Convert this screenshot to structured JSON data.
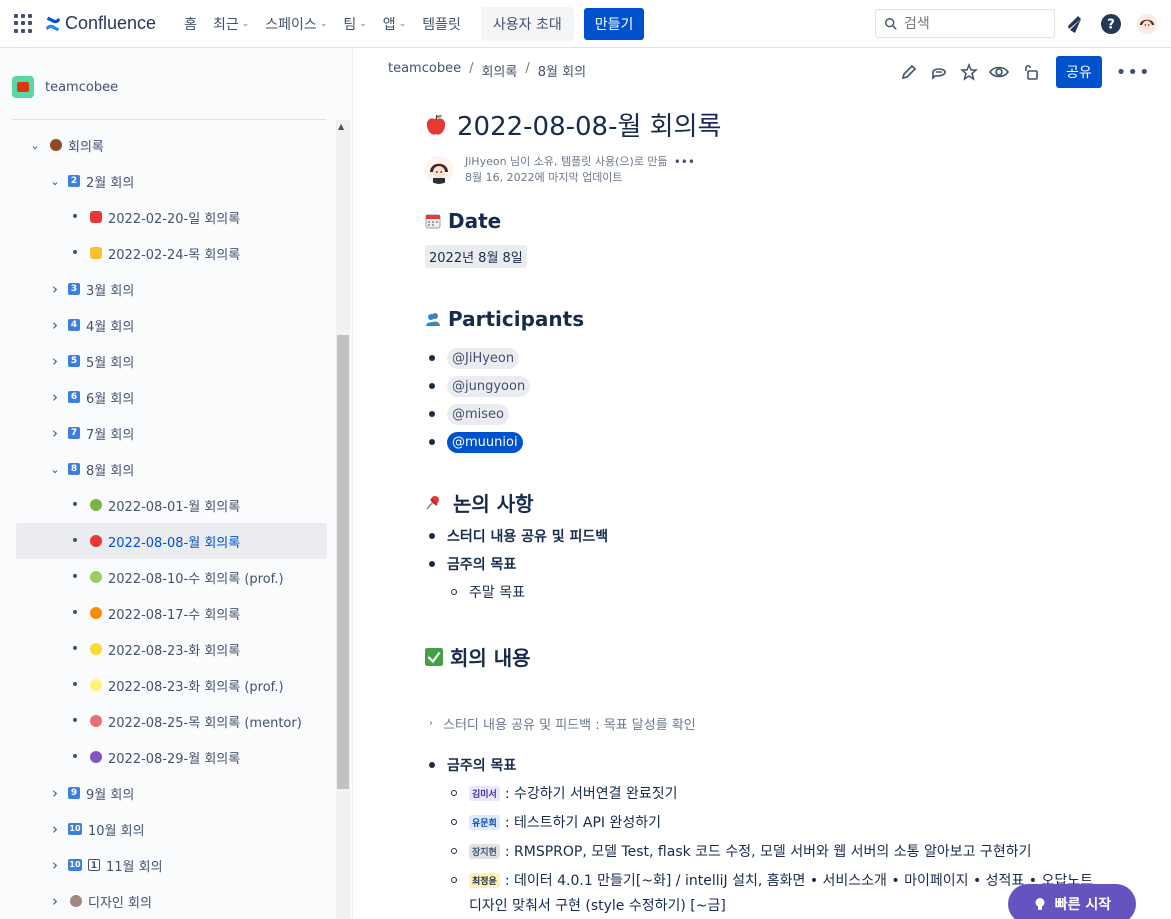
{
  "topnav": {
    "product": "Confluence",
    "items": [
      {
        "label": "홈",
        "dropdown": false
      },
      {
        "label": "최근",
        "dropdown": true
      },
      {
        "label": "스페이스",
        "dropdown": true
      },
      {
        "label": "팀",
        "dropdown": true
      },
      {
        "label": "앱",
        "dropdown": true
      },
      {
        "label": "템플릿",
        "dropdown": false
      }
    ],
    "invite_label": "사용자 초대",
    "create_label": "만들기",
    "search_placeholder": "검색",
    "icons": [
      "notifications-icon",
      "help-icon",
      "user-avatar"
    ]
  },
  "sidebar": {
    "space_name": "teamcobee",
    "tree": [
      {
        "label": "회의록",
        "level": 0,
        "expander": "expanded",
        "icon": "football"
      },
      {
        "label": "2월 회의",
        "level": 1,
        "expander": "expanded",
        "num": "2"
      },
      {
        "label": "2022-02-20-일 회의록",
        "level": 2,
        "expander": "bullet",
        "icon": "red-car"
      },
      {
        "label": "2022-02-24-목 회의록",
        "level": 2,
        "expander": "bullet",
        "icon": "taxi"
      },
      {
        "label": "3월 회의",
        "level": 1,
        "expander": "collapsed",
        "num": "3"
      },
      {
        "label": "4월 회의",
        "level": 1,
        "expander": "collapsed",
        "num": "4"
      },
      {
        "label": "5월 회의",
        "level": 1,
        "expander": "collapsed",
        "num": "5"
      },
      {
        "label": "6월 회의",
        "level": 1,
        "expander": "collapsed",
        "num": "6"
      },
      {
        "label": "7월 회의",
        "level": 1,
        "expander": "collapsed",
        "num": "7"
      },
      {
        "label": "8월 회의",
        "level": 1,
        "expander": "expanded",
        "num": "8"
      },
      {
        "label": "2022-08-01-월 회의록",
        "level": 2,
        "expander": "bullet",
        "icon": "green-apple"
      },
      {
        "label": "2022-08-08-월 회의록",
        "level": 2,
        "expander": "bullet",
        "icon": "red-apple",
        "active": true
      },
      {
        "label": "2022-08-10-수 회의록 (prof.)",
        "level": 2,
        "expander": "bullet",
        "icon": "pear"
      },
      {
        "label": "2022-08-17-수 회의록",
        "level": 2,
        "expander": "bullet",
        "icon": "orange"
      },
      {
        "label": "2022-08-23-화 회의록",
        "level": 2,
        "expander": "bullet",
        "icon": "lemon"
      },
      {
        "label": "2022-08-23-화 회의록 (prof.)",
        "level": 2,
        "expander": "bullet",
        "icon": "banana"
      },
      {
        "label": "2022-08-25-목 회의록 (mentor)",
        "level": 2,
        "expander": "bullet",
        "icon": "watermelon"
      },
      {
        "label": "2022-08-29-월 회의록",
        "level": 2,
        "expander": "bullet",
        "icon": "grapes"
      },
      {
        "label": "9월 회의",
        "level": 1,
        "expander": "collapsed",
        "num": "9"
      },
      {
        "label": "10월 회의",
        "level": 1,
        "expander": "collapsed",
        "num": "10"
      },
      {
        "label": "11월 회의",
        "level": 1,
        "expander": "collapsed",
        "num": "10",
        "num2": "1"
      },
      {
        "label": "디자인 회의",
        "level": 1,
        "expander": "collapsed",
        "icon": "cookie"
      }
    ]
  },
  "breadcrumb": [
    "teamcobee",
    "회의록",
    "8월 회의"
  ],
  "toolbar": {
    "share_label": "공유"
  },
  "page": {
    "title": "2022-08-08-월 회의록",
    "byline_1": "JiHyeon 님이 소유, 템플릿 사용(으)로 만듦",
    "byline_2": "8월 16, 2022에 마지막 업데이트",
    "sections": {
      "date_heading": "Date",
      "date_value": "2022년 8월 8일",
      "participants_heading": "Participants",
      "participants": [
        "@JiHyeon",
        "@jungyoon",
        "@miseo",
        "@muunioi"
      ],
      "discussion_heading": "논의 사항",
      "discussion_items": [
        "스터디 내용 공유 및 피드백",
        "금주의 목표"
      ],
      "discussion_sub": "주말 목표",
      "meeting_heading": "회의 내용",
      "expand_label": "스터디 내용 공유 및 피드백 : 목표 달성를 확인",
      "goals_heading": "금주의 목표",
      "goals": [
        {
          "name": "김미서",
          "color": "#403294",
          "text": ": 수강하기 서버연결 완료짓기"
        },
        {
          "name": "유문희",
          "color": "#0747a6",
          "text": ": 테스트하기 API 완성하기"
        },
        {
          "name": "장지현",
          "color": "#42526e",
          "text": ": RMSPROP, 모델 Test, flask 코드 수정, 모델 서버와 웹 서버의 소통 알아보고 구현하기"
        },
        {
          "name": "최정윤",
          "color": "#172b4d",
          "text": ": 데이터 4.0.1 만들기[~화] / intelliJ 설치, 홈화면 • 서비스소개 • 마이페이지 • 성적표 • 오답노트"
        },
        {
          "name": "",
          "color": "",
          "text": "디자인 맞춰서 구현 (style 수정하기) [~금]"
        }
      ]
    }
  },
  "quickstart_label": "빠른 시작"
}
